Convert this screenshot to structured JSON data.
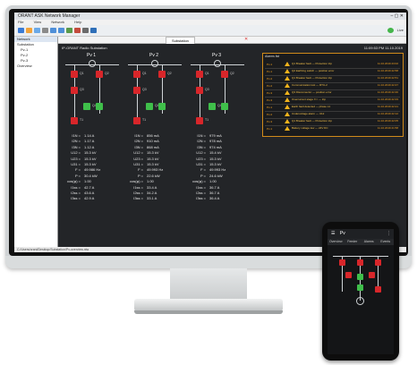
{
  "window": {
    "title": "ORANT ASK Network Manager",
    "menu": [
      "File",
      "View",
      "Network",
      "Help"
    ],
    "toolbar_right_label": "Live"
  },
  "sidebar": {
    "title": "Network",
    "items": [
      "Substation",
      "Pv-1",
      "Pv-2",
      "Pv-3",
      "Overview"
    ]
  },
  "tab": {
    "label": "Substation"
  },
  "workspace": {
    "title": "IP-ORANT Radio Substation",
    "timestamp": "11:09:53 PM 11.10.2019"
  },
  "feeders": [
    {
      "name": "Pv 1",
      "device_labels": [
        "Q1",
        "Q2",
        "Q3",
        "Q4",
        "T1"
      ],
      "measurements": [
        {
          "label": "I1N =",
          "value": "1.14 A"
        },
        {
          "label": "I2N =",
          "value": "1.17 A"
        },
        {
          "label": "I3N =",
          "value": "1.12 A"
        },
        {
          "label": "U12 =",
          "value": "15.3 kV"
        },
        {
          "label": "U23 =",
          "value": "15.3 kV"
        },
        {
          "label": "U31 =",
          "value": "15.3 kV"
        },
        {
          "label": "F =",
          "value": "49.986 Hz"
        },
        {
          "label": "P =",
          "value": "30.4 kW"
        },
        {
          "label": "cos(φ) =",
          "value": "1.00"
        },
        {
          "label": "I1ss =",
          "value": "42.7 A"
        },
        {
          "label": "I2ss =",
          "value": "43.6 A"
        },
        {
          "label": "I3ss =",
          "value": "42.9 A"
        }
      ]
    },
    {
      "name": "Pv 2",
      "device_labels": [
        "Q1",
        "Q2",
        "Q3",
        "Q4",
        "T1"
      ],
      "measurements": [
        {
          "label": "I1N =",
          "value": "856 mA"
        },
        {
          "label": "I2N =",
          "value": "910 mA"
        },
        {
          "label": "I3N =",
          "value": "868 mA"
        },
        {
          "label": "U12 =",
          "value": "15.3 kV"
        },
        {
          "label": "U23 =",
          "value": "15.3 kV"
        },
        {
          "label": "U31 =",
          "value": "15.3 kV"
        },
        {
          "label": "F =",
          "value": "49.993 Hz"
        },
        {
          "label": "P =",
          "value": "22.6 kW"
        },
        {
          "label": "cos(φ) =",
          "value": "1.00"
        },
        {
          "label": "I1ss =",
          "value": "33.4 A"
        },
        {
          "label": "I2ss =",
          "value": "34.2 A"
        },
        {
          "label": "I3ss =",
          "value": "33.1 A"
        }
      ]
    },
    {
      "name": "Pv 3",
      "device_labels": [
        "Q1",
        "Q2",
        "Q3",
        "Q4",
        "T1"
      ],
      "measurements": [
        {
          "label": "I1N =",
          "value": "979 mA"
        },
        {
          "label": "I2N =",
          "value": "978 mA"
        },
        {
          "label": "I3N =",
          "value": "974 mA"
        },
        {
          "label": "U12 =",
          "value": "15.4 kV"
        },
        {
          "label": "U23 =",
          "value": "15.3 kV"
        },
        {
          "label": "U31 =",
          "value": "15.3 kV"
        },
        {
          "label": "F =",
          "value": "49.993 Hz"
        },
        {
          "label": "P =",
          "value": "24.6 kW"
        },
        {
          "label": "cos(φ) =",
          "value": "1.00"
        },
        {
          "label": "I1ss =",
          "value": "36.7 A"
        },
        {
          "label": "I2ss =",
          "value": "36.7 A"
        },
        {
          "label": "I3ss =",
          "value": "36.4 A"
        }
      ]
    }
  ],
  "alarms": {
    "title": "Alarms list",
    "rows": [
      {
        "id": "Pv-1",
        "message": "Q1 Breaker fault — Protection trip",
        "time": "11.10.2019 23:02"
      },
      {
        "id": "Pv-1",
        "message": "Q2 Earthing switch — position error",
        "time": "11.10.2019 22:58"
      },
      {
        "id": "Pv-2",
        "message": "Q1 Breaker fault — Protection trip",
        "time": "11.10.2019 22:51"
      },
      {
        "id": "Pv-2",
        "message": "Communication lost — RTU-2",
        "time": "11.10.2019 22:47"
      },
      {
        "id": "Pv-3",
        "message": "Q3 Disconnector — position error",
        "time": "11.10.2019 22:40"
      },
      {
        "id": "Pv-3",
        "message": "Overcurrent stage I>> — trip",
        "time": "11.10.2019 22:33"
      },
      {
        "id": "Pv-1",
        "message": "Earth fault detected — phase L1",
        "time": "11.10.2019 22:21"
      },
      {
        "id": "Pv-2",
        "message": "Undervoltage alarm — U12",
        "time": "11.10.2019 22:12"
      },
      {
        "id": "Pv-3",
        "message": "Q1 Breaker fault — Protection trip",
        "time": "11.10.2019 22:05"
      },
      {
        "id": "Pv-1",
        "message": "Battery voltage low — 24V DC",
        "time": "11.10.2019 21:58"
      }
    ]
  },
  "statusbar": {
    "text": "C:/Users/orant/Desktop/Substation/Pv-overview.ntw"
  },
  "phone": {
    "title": "Pv",
    "tabs": [
      "Overview",
      "Feeder",
      "Alarms",
      "Events"
    ]
  },
  "colors": {
    "breaker_closed": "#d8262a",
    "breaker_open": "#3fbf4a",
    "alarm_accent": "#f0a020",
    "workspace_bg": "#232528"
  }
}
